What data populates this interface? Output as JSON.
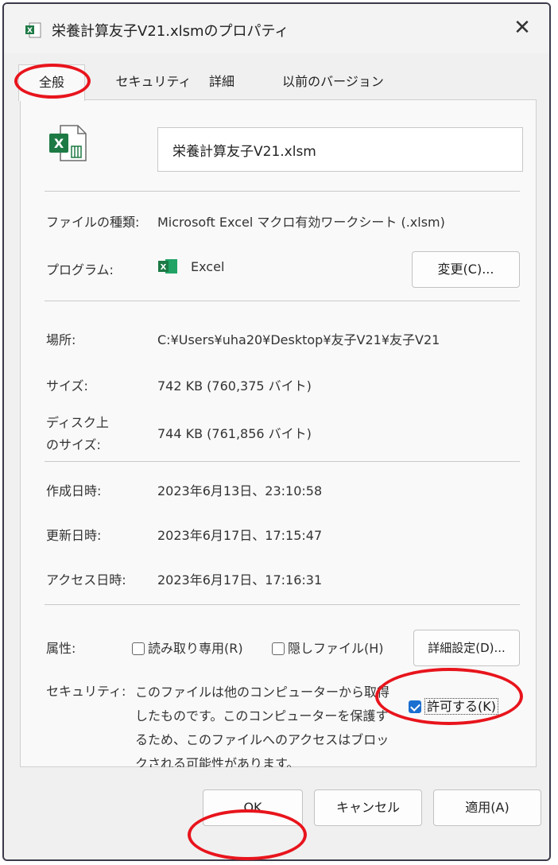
{
  "window": {
    "title": "栄養計算友子V21.xlsmのプロパティ",
    "close_glyph": "✕"
  },
  "tabs": [
    {
      "label": "全般",
      "active": true
    },
    {
      "label": "セキュリティ",
      "active": false
    },
    {
      "label": "詳細",
      "active": false
    },
    {
      "label": "以前のバージョン",
      "active": false
    }
  ],
  "file": {
    "name": "栄養計算友子V21.xlsm",
    "icon": "excel-file-icon"
  },
  "props": {
    "type_label": "ファイルの種類:",
    "type_value": "Microsoft Excel マクロ有効ワークシート (.xlsm)",
    "program_label": "プログラム:",
    "program_value": "Excel",
    "change_button": "変更(C)...",
    "location_label": "場所:",
    "location_value": "C:¥Users¥uha20¥Desktop¥友子V21¥友子V21",
    "size_label": "サイズ:",
    "size_value": "742 KB (760,375 バイト)",
    "disk_size_label_1": "ディスク上",
    "disk_size_label_2": "のサイズ:",
    "disk_size_value": "744 KB (761,856 バイト)",
    "created_label": "作成日時:",
    "created_value": "2023年6月13日、23:10:58",
    "modified_label": "更新日時:",
    "modified_value": "2023年6月17日、17:15:47",
    "accessed_label": "アクセス日時:",
    "accessed_value": "2023年6月17日、17:16:31"
  },
  "attributes": {
    "label": "属性:",
    "readonly": {
      "label": "読み取り専用(R)",
      "checked": false
    },
    "hidden": {
      "label": "隠しファイル(H)",
      "checked": false
    },
    "advanced_button": "詳細設定(D)..."
  },
  "security": {
    "label": "セキュリティ:",
    "message": "このファイルは他のコンピューターから取得したものです。このコンピューターを保護するため、このファイルへのアクセスはブロックされる可能性があります。",
    "allow": {
      "label": "許可する(K)",
      "checked": true
    }
  },
  "footer": {
    "ok": "OK",
    "cancel": "キャンセル",
    "apply": "適用(A)"
  },
  "colors": {
    "annotation": "#e8141c",
    "excel_green": "#1d7a45",
    "checkbox_blue": "#1a6fd0"
  }
}
